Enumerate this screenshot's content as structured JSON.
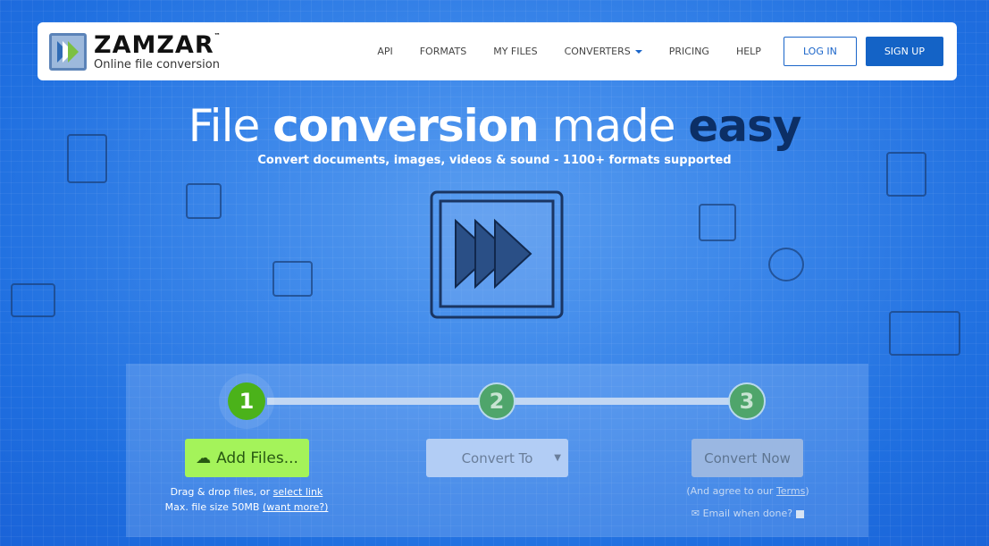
{
  "nav": {
    "brand": "ZAMZAR",
    "trademark": "™",
    "tagline": "Online file conversion",
    "items": [
      "API",
      "FORMATS",
      "MY FILES",
      "CONVERTERS",
      "PRICING",
      "HELP"
    ],
    "login": "LOG IN",
    "signup": "SIGN UP"
  },
  "hero": {
    "title_pre": "File",
    "title_bold": "conversion",
    "title_mid": "made",
    "title_accent": "easy",
    "subtitle": "Convert documents, images, videos & sound - 1100+ formats supported"
  },
  "steps": {
    "numbers": [
      "1",
      "2",
      "3"
    ],
    "add_files": "Add Files...",
    "drag_text": "Drag & drop files, or",
    "select_link": "select link",
    "max_text": "Max. file size 50MB",
    "want_more": "(want more?)",
    "convert_to": "Convert To",
    "convert_now": "Convert Now",
    "agree_pre": "(And agree to our",
    "terms": "Terms",
    "agree_post": ")",
    "email": "Email when done?"
  },
  "colors": {
    "accent": "#1463c6",
    "step_active": "#4bb21a",
    "add_button": "#a4f35a"
  }
}
